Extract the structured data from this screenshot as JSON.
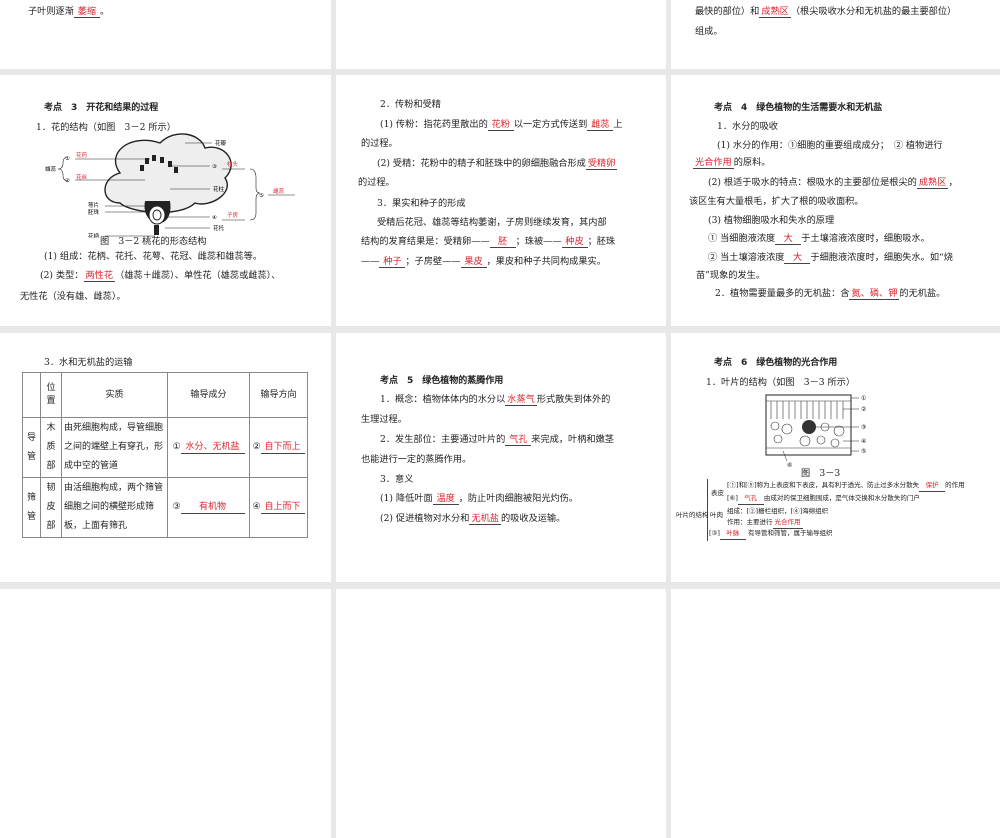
{
  "slides": {
    "s1": {
      "p1": [
        {
          "t": "子叶则逐渐"
        },
        {
          "b": "萎缩"
        },
        {
          "t": "。"
        }
      ]
    },
    "s3": {
      "p1": [
        {
          "t": "最快的部位）和"
        },
        {
          "b": "成熟区"
        },
        {
          "t": "（根尖吸收水分和无机盐的最主要部位）"
        }
      ],
      "p2": [
        {
          "t": "组成。"
        }
      ]
    },
    "s4": {
      "title": "考点　3　开花和结果的过程",
      "p1": [
        {
          "t": "1．花的结构（如图　3－2 所示）"
        }
      ],
      "diagram": {
        "petal": "花瓣",
        "stamen": "雄蕊",
        "sepal": "萼片",
        "ovule": "胚珠",
        "stalk": "花柄",
        "style": "花柱",
        "receptacle": "花托",
        "n1": "①",
        "n2": "②",
        "n3": "③",
        "n4": "④",
        "n5": "⑤",
        "a1": "花药",
        "a2": "花丝",
        "a3": "柱头",
        "a4": "子房",
        "a5": "雌蕊"
      },
      "caption": "图　3－2 桃花的形态结构",
      "p2": [
        {
          "t": "(1) 组成：花柄、花托、花萼、花冠、雌蕊和雄蕊等。"
        }
      ],
      "p3": [
        {
          "t": "(2) 类型："
        },
        {
          "b": "两性花"
        },
        {
          "t": "（雄蕊＋雌蕊）、单性花（雄蕊或雌蕊）、"
        }
      ],
      "p4": [
        {
          "t": "无性花（没有雄、雌蕊）。"
        }
      ]
    },
    "s5": {
      "p1": [
        {
          "t": "2．传粉和受精"
        }
      ],
      "p2": [
        {
          "t": "(1) 传粉：指花药里散出的"
        },
        {
          "b": "花粉"
        },
        {
          "t": "以一定方式传送到"
        },
        {
          "b": "雌蕊"
        },
        {
          "t": "上"
        }
      ],
      "p3": [
        {
          "t": "的过程。"
        }
      ],
      "p4": [
        {
          "t": "(2) 受精：花粉中的精子和胚珠中的卵细胞融合形成"
        },
        {
          "b": "受精卵"
        }
      ],
      "p5": [
        {
          "t": "的过程。"
        }
      ],
      "p6": [
        {
          "t": "3．果实和种子的形成"
        }
      ],
      "p7": [
        {
          "t": "受精后花冠、雄蕊等结构萎谢，子房则继续发育，其内部"
        }
      ],
      "p8": [
        {
          "t": "结构的发育结果是：受精卵——"
        },
        {
          "b": "胚"
        },
        {
          "t": "；珠被——"
        },
        {
          "b": "种皮"
        },
        {
          "t": "；胚珠"
        }
      ],
      "p9": [
        {
          "t": "——"
        },
        {
          "b": "种子"
        },
        {
          "t": "；子房壁——"
        },
        {
          "b": "果皮"
        },
        {
          "t": "，果皮和种子共同构成果实。"
        }
      ]
    },
    "s6": {
      "title": "考点　4　绿色植物的生活需要水和无机盐",
      "p1": [
        {
          "t": "1．水分的吸收"
        }
      ],
      "p2": [
        {
          "t": "(1) 水分的作用：①细胞的重要组成成分；　② 植物进行"
        }
      ],
      "p3": [
        {
          "b": "光合作用"
        },
        {
          "t": "的原料。"
        }
      ],
      "p4": [
        {
          "t": "(2) 根适于吸水的特点：根吸水的主要部位是根尖的"
        },
        {
          "b": "成熟区"
        },
        {
          "t": "，"
        }
      ],
      "p5": [
        {
          "t": "该区生有大量根毛，扩大了根的吸收面积。"
        }
      ],
      "p6": [
        {
          "t": "(3) 植物细胞吸水和失水的原理"
        }
      ],
      "p7": [
        {
          "t": "① 当细胞液浓度"
        },
        {
          "b": "大"
        },
        {
          "t": "于土壤溶液浓度时，细胞吸水。"
        }
      ],
      "p8": [
        {
          "t": "② 当土壤溶液浓度"
        },
        {
          "b": "大"
        },
        {
          "t": "于细胞液浓度时，细胞失水。如“烧"
        }
      ],
      "p9": [
        {
          "t": "苗”现象的发生。"
        }
      ],
      "p10": [
        {
          "t": "2．植物需要量最多的无机盐：含"
        },
        {
          "b": "氮、磷、钾"
        },
        {
          "t": "的无机盐。"
        }
      ]
    },
    "s7": {
      "p1": [
        {
          "t": "3．水和无机盐的运输"
        }
      ],
      "table": {
        "headers": [
          "",
          "位置",
          "实质",
          "输导成分",
          "输导方向"
        ],
        "rows": [
          {
            "type": "导管",
            "pos": "木质部",
            "desc": "由死细胞构成，导管细胞之间的端壁上有穿孔，形成中空的管道",
            "num1": "①",
            "comp": "水分、无机盐",
            "num2": "②",
            "dir": "自下而上"
          },
          {
            "type": "筛管",
            "pos": "韧皮部",
            "desc": "由活细胞构成，两个筛管细胞之间的横壁形成筛板，上面有筛孔",
            "num1": "③",
            "comp": "有机物",
            "num2": "④",
            "dir": "自上而下"
          }
        ]
      }
    },
    "s8": {
      "title": "考点　5　绿色植物的蒸腾作用",
      "p1": [
        {
          "t": "1．概念：植物体体内的水分以"
        },
        {
          "b": "水蒸气"
        },
        {
          "t": "形式散失到体外的"
        }
      ],
      "p2": [
        {
          "t": "生理过程。"
        }
      ],
      "p3": [
        {
          "t": "2．发生部位：主要通过叶片的"
        },
        {
          "b": "气孔"
        },
        {
          "t": "来完成，叶柄和嫩茎"
        }
      ],
      "p4": [
        {
          "t": "也能进行一定的蒸腾作用。"
        }
      ],
      "p5": [
        {
          "t": "3．意义"
        }
      ],
      "p6": [
        {
          "t": "(1) 降低叶面"
        },
        {
          "b": "温度"
        },
        {
          "t": "，防止叶肉细胞被阳光灼伤。"
        }
      ],
      "p7": [
        {
          "t": "(2) 促进植物对水分和"
        },
        {
          "b": "无机盐"
        },
        {
          "t": "的吸收及运输。"
        }
      ]
    },
    "s9": {
      "title": "考点　6　绿色植物的光合作用",
      "p1": [
        {
          "t": "1．叶片的结构（如图　3－3 所示）"
        }
      ],
      "labels": [
        "①",
        "②",
        "③",
        "④",
        "⑤",
        "⑥"
      ],
      "caption": "图　3－3",
      "root": "叶片的结构",
      "epi": "表皮",
      "meso": "叶肉",
      "q1": [
        {
          "t": "[①]和[⑤]称为上表皮和下表皮，具有利于透光、防止过多水分散失"
        },
        {
          "b": "保护"
        },
        {
          "t": "的作用"
        }
      ],
      "q2": [
        {
          "t": "[⑥]"
        },
        {
          "b": "气孔"
        },
        {
          "t": "由成对的保卫细胞围成，是气体交换和水分散失的门户"
        }
      ],
      "q3": [
        {
          "t": "组成：[②]栅栏组织，[④]海绵组织"
        }
      ],
      "q4": [
        {
          "t": "作用：主要进行"
        },
        {
          "b": "光合作用"
        }
      ],
      "q5": [
        {
          "t": "[③]"
        },
        {
          "b": "叶脉"
        },
        {
          "t": " 有导管和筛管，属于输导组织"
        }
      ]
    }
  }
}
